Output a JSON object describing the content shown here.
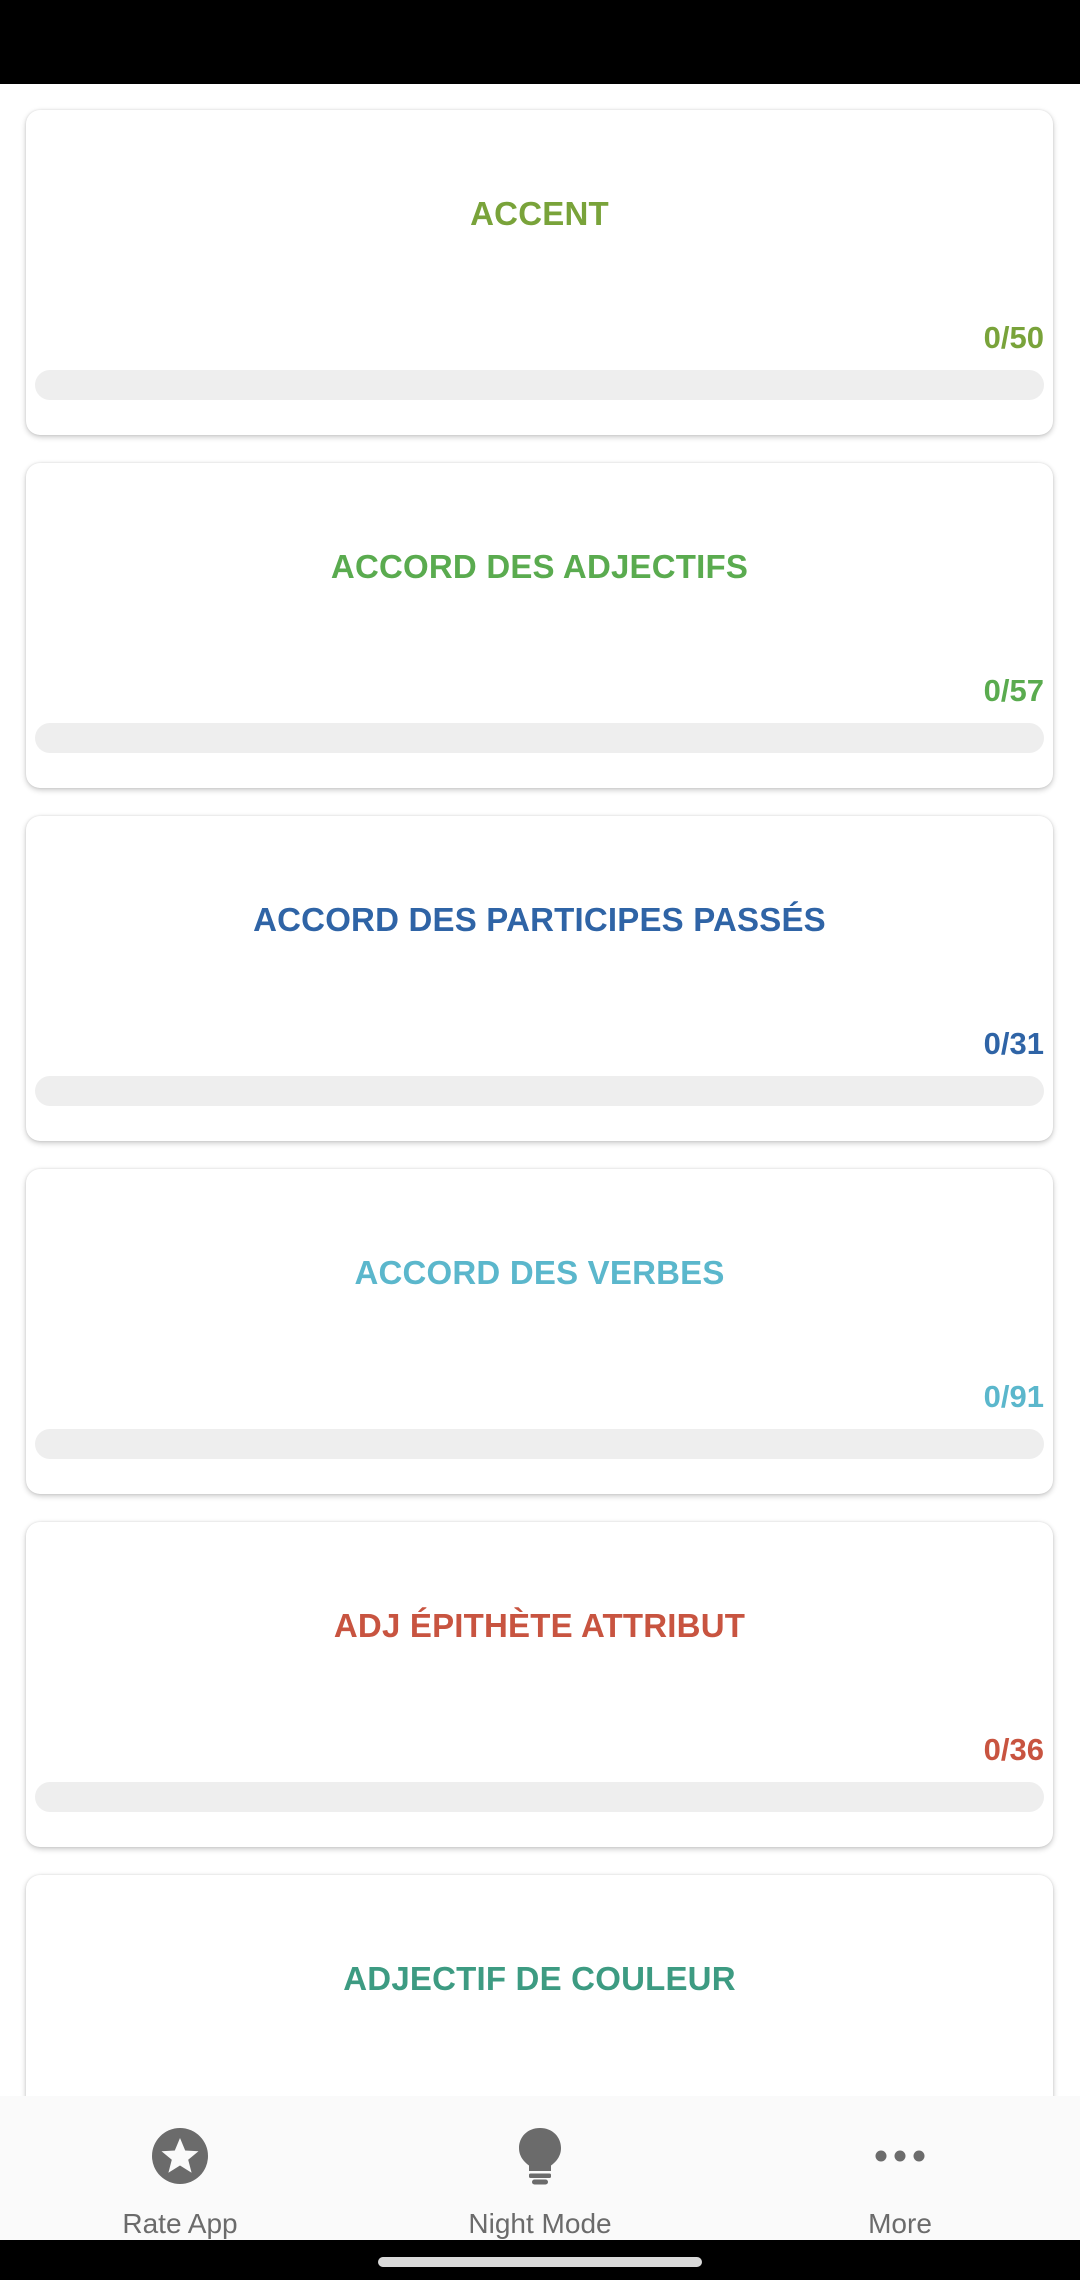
{
  "cards": [
    {
      "title": "ACCENT",
      "count": "0/50",
      "progress": 0,
      "color": "#79a33a"
    },
    {
      "title": "ACCORD DES ADJECTIFS",
      "count": "0/57",
      "progress": 0,
      "color": "#5aab4f"
    },
    {
      "title": "ACCORD DES PARTICIPES PASSÉS",
      "count": "0/31",
      "progress": 0,
      "color": "#2f64a6"
    },
    {
      "title": "ACCORD DES VERBES",
      "count": "0/91",
      "progress": 0,
      "color": "#5bb7cc"
    },
    {
      "title": "ADJ ÉPITHÈTE ATTRIBUT",
      "count": "0/36",
      "progress": 0,
      "color": "#c85440"
    },
    {
      "title": "ADJECTIF DE COULEUR",
      "count": "",
      "progress": 0,
      "color": "#3d9b82"
    }
  ],
  "bottom_nav": {
    "items": [
      {
        "label": "Rate App",
        "icon": "star-icon"
      },
      {
        "label": "Night Mode",
        "icon": "lightbulb-icon"
      },
      {
        "label": "More",
        "icon": "more-icon"
      }
    ],
    "icon_color": "#6b6b6b"
  }
}
